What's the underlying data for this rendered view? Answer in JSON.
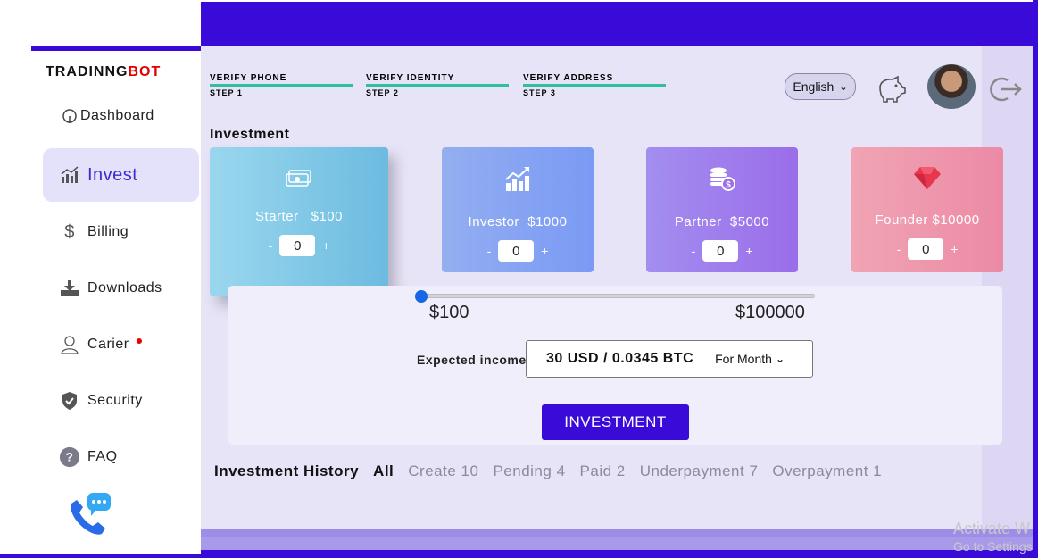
{
  "brand": {
    "part1": "TRADINNG",
    "part2": "BOT"
  },
  "sidebar": {
    "items": [
      {
        "label": "Dashboard",
        "icon": "dashboard-icon"
      },
      {
        "label": "Invest",
        "icon": "chart-icon"
      },
      {
        "label": "Billing",
        "icon": "dollar-icon"
      },
      {
        "label": "Downloads",
        "icon": "download-icon"
      },
      {
        "label": "Carier",
        "icon": "user-icon"
      },
      {
        "label": "Security",
        "icon": "shield-icon"
      },
      {
        "label": "FAQ",
        "icon": "question-icon"
      }
    ],
    "active": "Invest"
  },
  "steps": [
    {
      "title": "VERIFY PHONE",
      "sub": "STEP 1"
    },
    {
      "title": "VERIFY IDENTITY",
      "sub": "STEP 2"
    },
    {
      "title": "VERIFY ADDRESS",
      "sub": "STEP 3"
    }
  ],
  "header": {
    "language": "English"
  },
  "investment": {
    "title": "Investment",
    "cards": [
      {
        "label": "Starter   $100",
        "qty": "0"
      },
      {
        "label": "Investor  $1000",
        "qty": "0"
      },
      {
        "label": "Partner  $5000",
        "qty": "0"
      },
      {
        "label": "Founder $10000",
        "qty": "0"
      }
    ],
    "minus": "-",
    "plus": "+",
    "slider": {
      "min_label": "$100",
      "max_label": "$100000",
      "value_fraction": 0
    },
    "expected_label": "Expected income",
    "expected_value": "30 USD / 0.0345 BTC",
    "period": "For Month",
    "button": "INVESTMENT"
  },
  "history": {
    "title": "Investment History",
    "filters": [
      "All",
      "Create 10",
      "Pending 4",
      "Paid 2",
      "Underpayment 7",
      "Overpayment 1"
    ]
  },
  "watermark": {
    "line1": "Activate W",
    "line2": "Go to Settings"
  },
  "colors": {
    "primary": "#3a0ad8",
    "accent_line": "#2fbfa0",
    "bg": "#e8e4f7"
  }
}
